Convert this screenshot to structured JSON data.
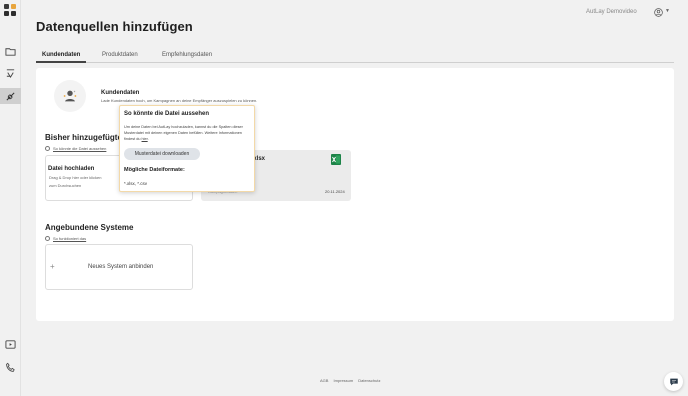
{
  "app": {
    "page_title": "Datenquellen hinzufügen",
    "account_name": "AutLay Demovideo"
  },
  "sidebar": {
    "items": [
      {
        "icon": "folder-icon"
      },
      {
        "icon": "campaign-icon"
      },
      {
        "icon": "data-sources-icon",
        "active": true
      },
      {
        "icon": "video-icon"
      },
      {
        "icon": "phone-icon"
      }
    ]
  },
  "tabs": [
    {
      "label": "Kundendaten",
      "active": true
    },
    {
      "label": "Produktdaten",
      "active": false
    },
    {
      "label": "Empfehlungsdaten",
      "active": false
    }
  ],
  "source": {
    "title": "Kundendaten",
    "description": "Lade Kundendaten hoch, um Kampagnen an deine Empfänger auszuspielen zu können."
  },
  "added_section": {
    "title": "Bisher hinzugefügte",
    "help_link": "So könnte die Datei aussehen"
  },
  "upload": {
    "title": "Datei hochladen",
    "description": "Drag & Drop hier oder klicken zum Durchsuchen"
  },
  "file": {
    "name": "ger(2).xlsx",
    "meta": "Kampagnedaten",
    "date": "20.11.2024"
  },
  "systems_section": {
    "title": "Angebundene Systeme",
    "help_link": "So funktioniert das",
    "connect_label": "Neues System anbinden",
    "plus": "+"
  },
  "popover": {
    "title": "So könnte die Datei aussehen",
    "text": "Um deine Daten bei AutLay hochzuladen, kannst du die Spalten dieser Musterdatei mit deinen eigenen Daten befüllen. Weitere Informationen findest du ",
    "link": "hier",
    "button": "Musterdatei downloaden",
    "formats_title": "Mögliche Dateiformate:",
    "formats": "*.xlsx, *.csv"
  },
  "footer": {
    "links": [
      "AGB",
      "Impressum",
      "Datenschutz"
    ]
  },
  "colors": {
    "logo": [
      "#e8a53d",
      "#3a3a3a",
      "#f0c070",
      "#2e2e2e"
    ],
    "excel": "#1d8348",
    "popover_border": "#f3d9a8"
  }
}
